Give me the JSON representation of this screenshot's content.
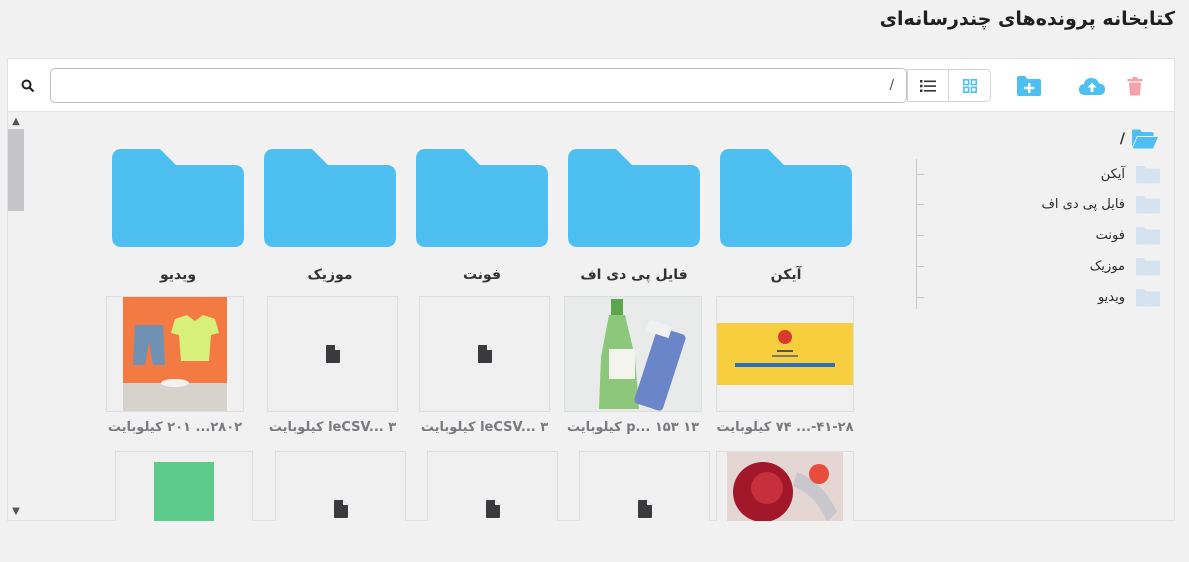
{
  "page": {
    "title": "کتابخانه پرونده‌های چندرسانه‌ای"
  },
  "toolbar": {
    "path_value": "/",
    "icons": [
      "search-icon",
      "list-view-icon",
      "grid-view-icon",
      "new-folder-icon",
      "upload-icon",
      "trash-icon"
    ],
    "colors": {
      "accent": "#4dbff0",
      "delete": "#f5a3a8"
    }
  },
  "tree": {
    "root_label": "/",
    "items": [
      {
        "label": "آیکن"
      },
      {
        "label": "فایل پی دی اف"
      },
      {
        "label": "فونت"
      },
      {
        "label": "موزیک"
      },
      {
        "label": "ویدیو"
      }
    ]
  },
  "folders": [
    {
      "label": "آیکن"
    },
    {
      "label": "فایل پی دی اف"
    },
    {
      "label": "فونت"
    },
    {
      "label": "موزیک"
    },
    {
      "label": "ویدیو"
    }
  ],
  "files": [
    {
      "name": "۴۱-۲۸-... ۷۴ کیلوبایت",
      "thumb": "banner-image"
    },
    {
      "name": "۱۳ p... ۱۵۳ کیلوبایت",
      "thumb": "cosmetics-image"
    },
    {
      "name": "leCSV... ۳ کیلوبایت",
      "thumb": "file-icon"
    },
    {
      "name": "leCSV... ۳ کیلوبایت",
      "thumb": "file-icon"
    },
    {
      "name": "۲۸۰۲... ۲۰۱ کیلوبایت",
      "thumb": "clothes-image"
    },
    {
      "name": "",
      "thumb": "rose-image"
    },
    {
      "name": "",
      "thumb": "file-icon"
    },
    {
      "name": "",
      "thumb": "file-icon"
    },
    {
      "name": "",
      "thumb": "file-icon"
    },
    {
      "name": "",
      "thumb": "green-square-image"
    }
  ]
}
